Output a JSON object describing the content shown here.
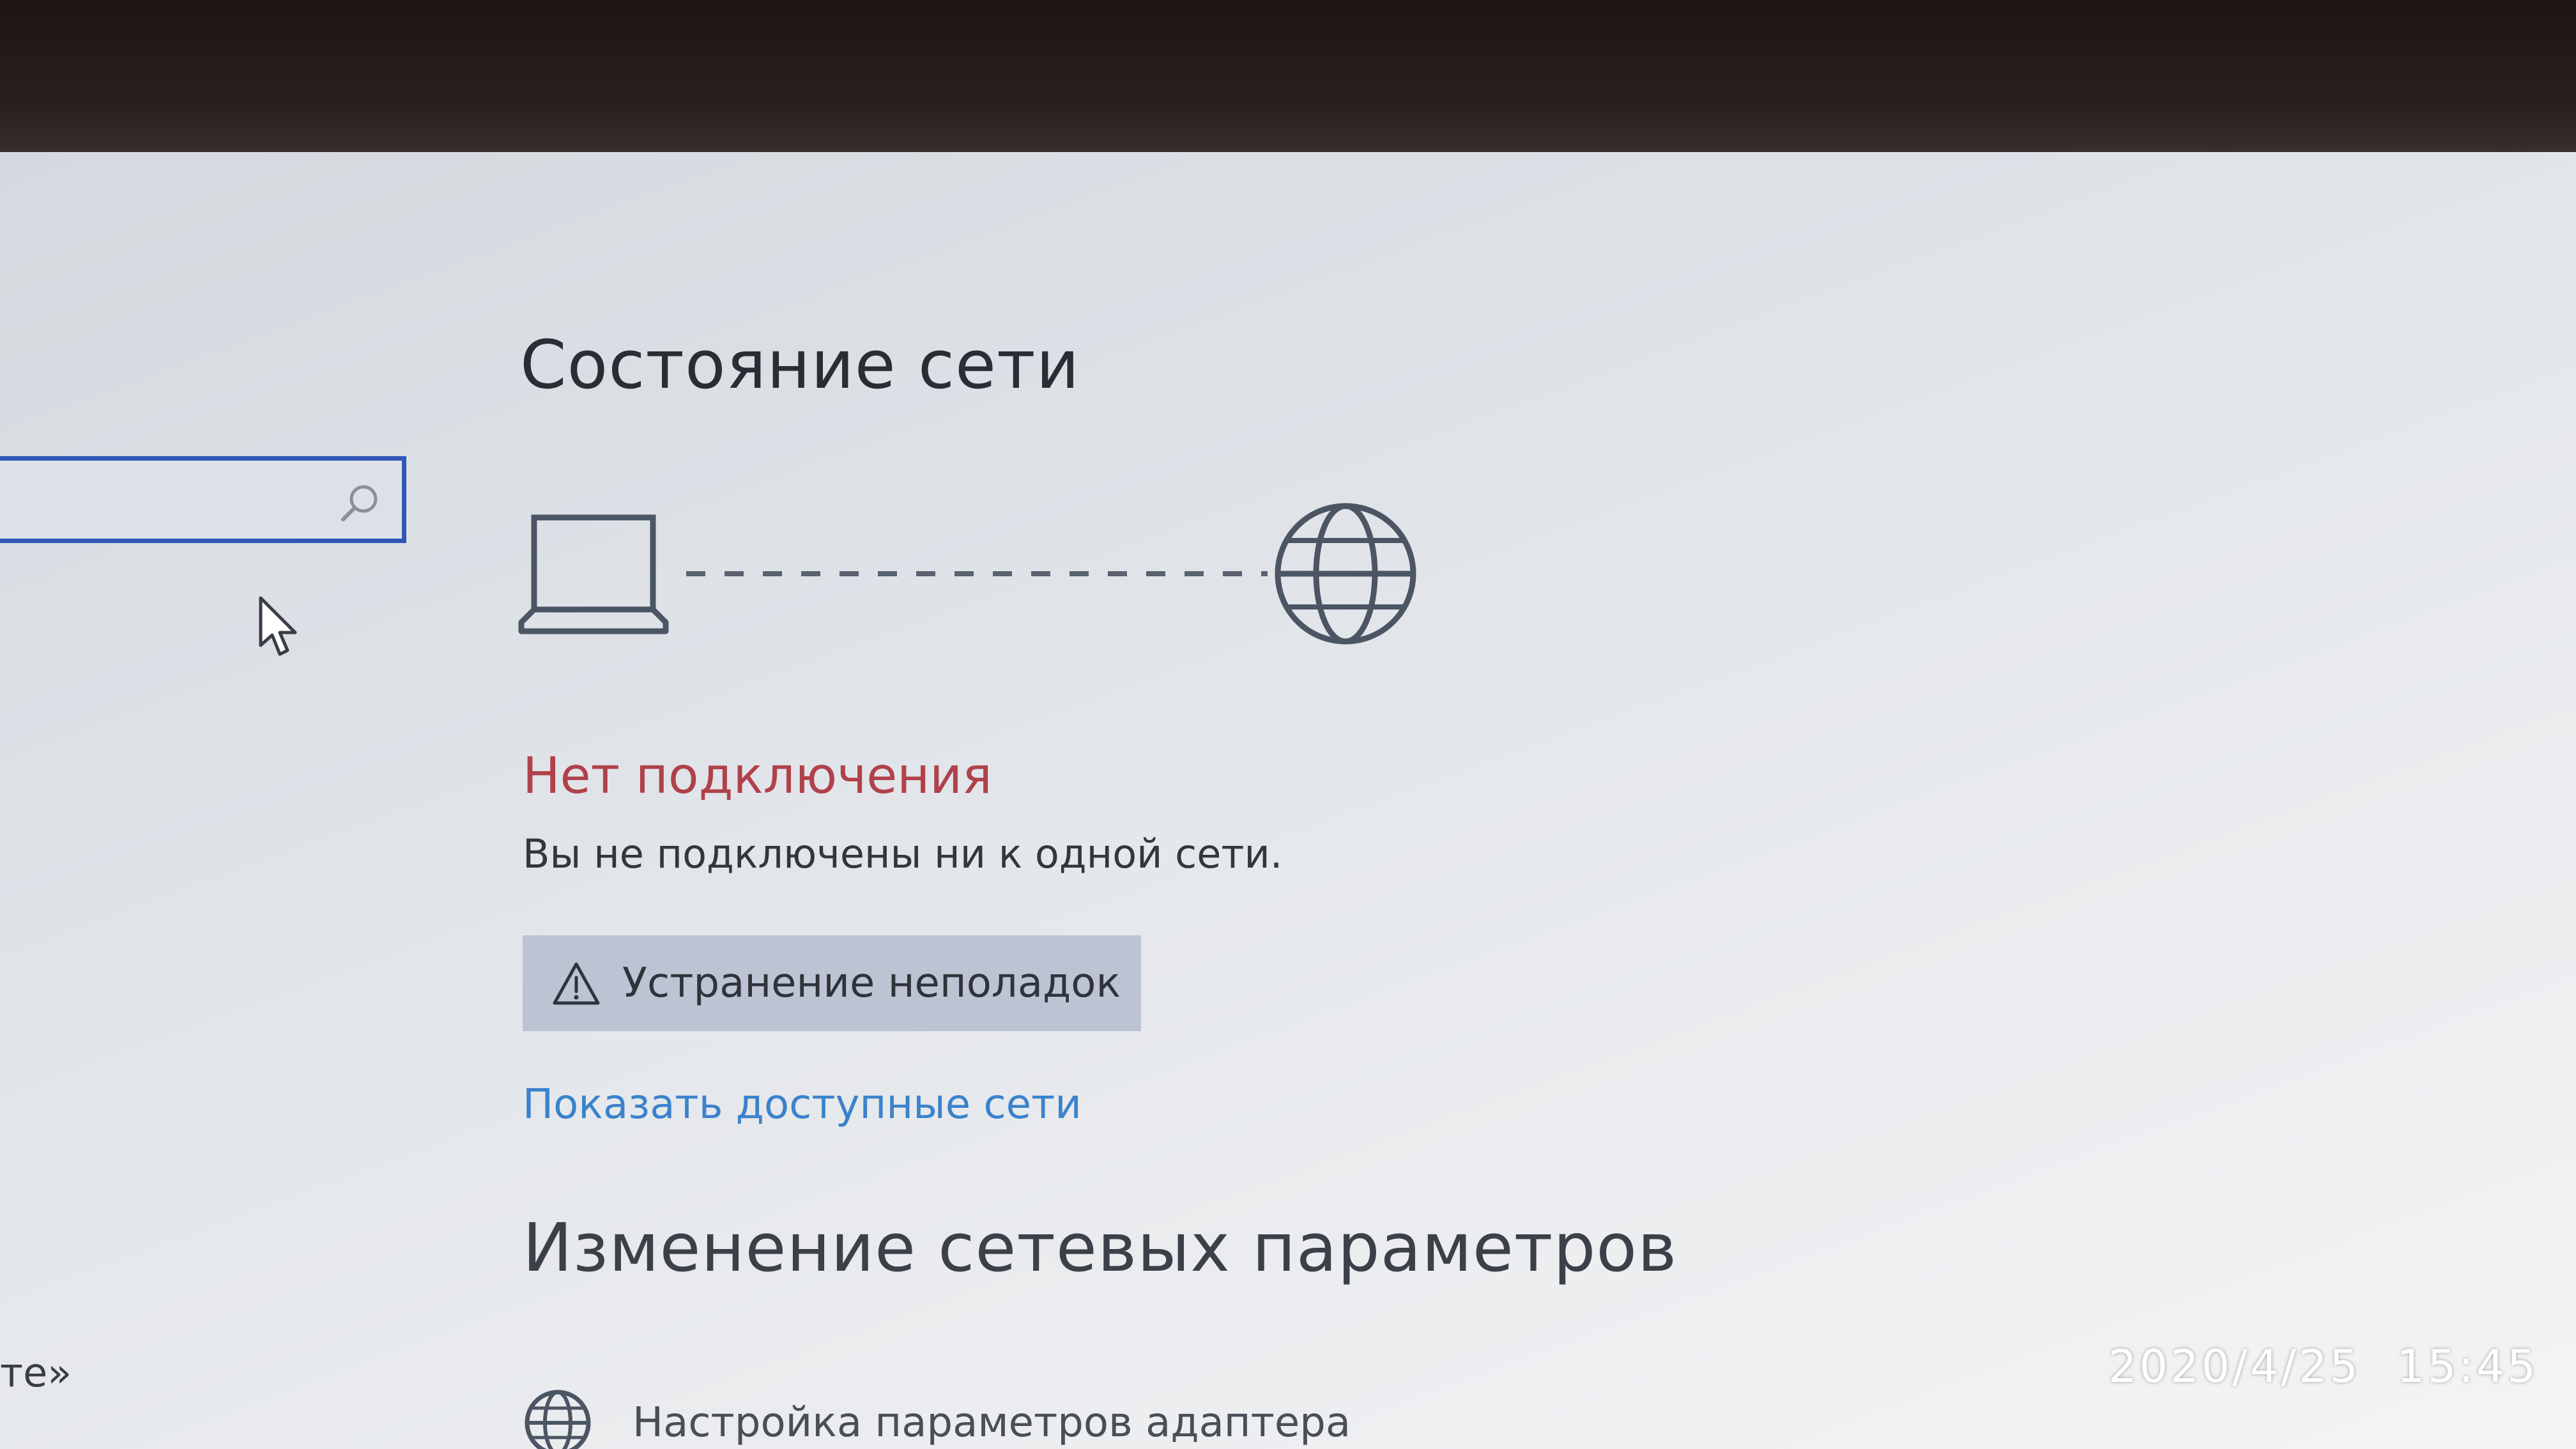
{
  "window": {
    "title": "Состояние сети"
  },
  "sidebar": {
    "search": {
      "value": "",
      "placeholder": ""
    },
    "cut_text": "те»"
  },
  "network_diagram": {
    "device_icon": "laptop-icon",
    "connection": "dashed-line",
    "internet_icon": "globe-icon",
    "icon_color": "#4b5563"
  },
  "status": {
    "heading": "Нет подключения",
    "heading_color": "#b0414a",
    "description": "Вы не подключены ни к одной сети."
  },
  "actions": {
    "troubleshoot_label": "Устранение неполадок",
    "troubleshoot_icon": "warning-icon",
    "show_networks_link": "Показать доступные сети",
    "link_color": "#3b82cc"
  },
  "change_settings": {
    "title": "Изменение сетевых параметров",
    "items": [
      {
        "icon": "globe-adapter-icon",
        "label": "Настройка параметров адаптера"
      }
    ]
  },
  "photo_overlay": {
    "timestamp": "2020/4/25 15:45"
  }
}
